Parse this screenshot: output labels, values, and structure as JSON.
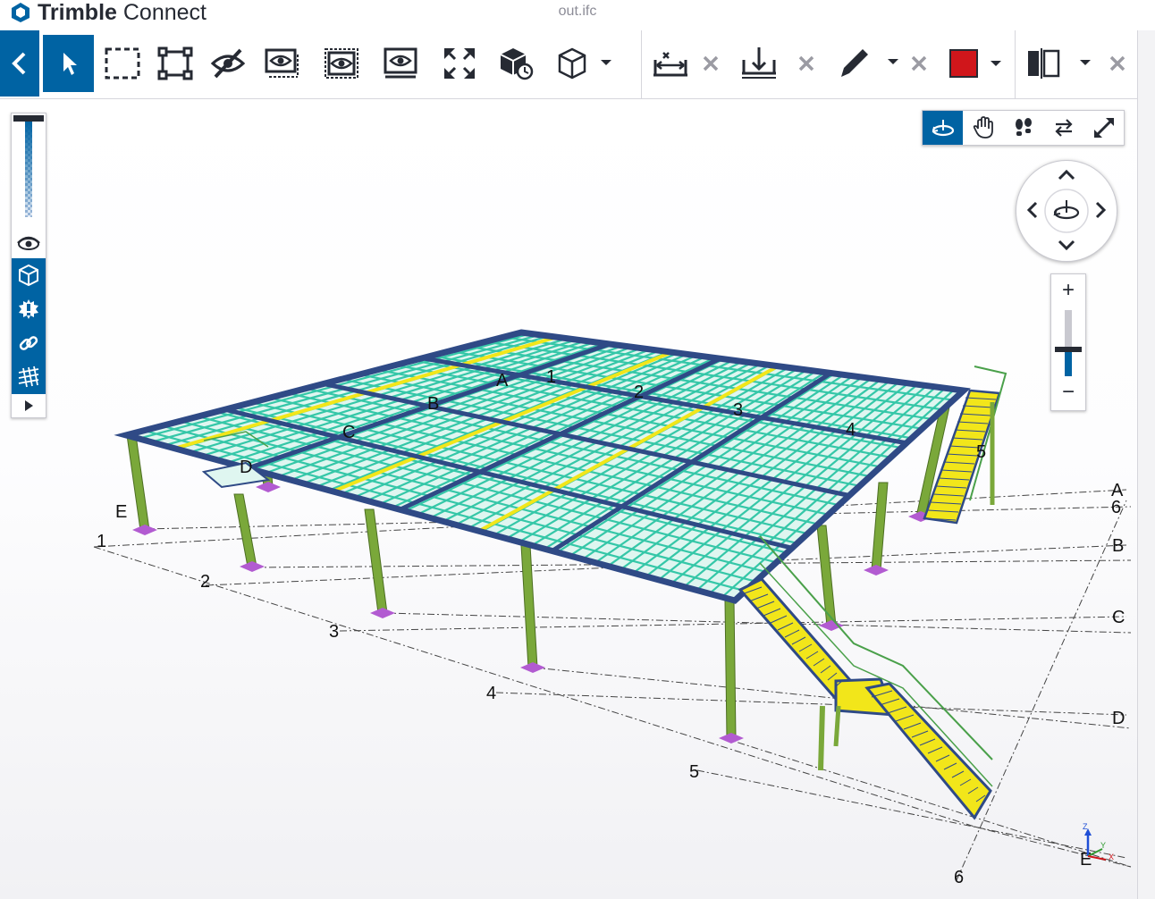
{
  "app": {
    "brand_bold": "Trimble",
    "brand_light": " Connect",
    "filename": "out.ifc"
  },
  "colors": {
    "accent": "#0063a3",
    "markup_color": "#d0161b",
    "steel_beam": "#2f4a86",
    "joist": "#35c7a8",
    "column": "#7aa83a",
    "stair": "#f2e61a",
    "baseplate": "#b25bd1"
  },
  "toolbar": {
    "icons": [
      "back-icon",
      "pointer-icon",
      "rectangle-select-icon",
      "fit-selection-icon",
      "hide-icon",
      "show-only-icon",
      "isolate-icon",
      "show-all-icon",
      "fit-all-icon",
      "object-clip-icon",
      "cube-view-icon",
      "measure-icon",
      "close-icon",
      "section-plane-icon",
      "close-icon",
      "pencil-icon",
      "close-icon",
      "color-swatch-icon",
      "split-view-icon",
      "close-icon"
    ]
  },
  "left_panel": {
    "icons": [
      "slider-handle-icon",
      "eye-icon",
      "cube-icon",
      "gear-icon",
      "link-icon",
      "grid-icon",
      "expand-icon"
    ]
  },
  "nav_modes": {
    "icons": [
      "orbit-icon",
      "pan-icon",
      "walk-icon",
      "swap-icon",
      "fullscreen-icon"
    ]
  },
  "zoom": {
    "plus": "+",
    "minus": "−",
    "level": 0.4
  },
  "grid_labels": {
    "top_letters": [
      "A",
      "B",
      "C",
      "D"
    ],
    "top_numbers": [
      "1",
      "2",
      "3",
      "4",
      "5"
    ],
    "left_letter": "E",
    "left_numbers": [
      "1",
      "2",
      "3",
      "4",
      "5",
      "6"
    ],
    "right_letters": [
      "A",
      "B",
      "C",
      "D",
      "E"
    ],
    "right_number": "6"
  },
  "axes": {
    "z": "Z",
    "y": "Y",
    "x": "X"
  }
}
